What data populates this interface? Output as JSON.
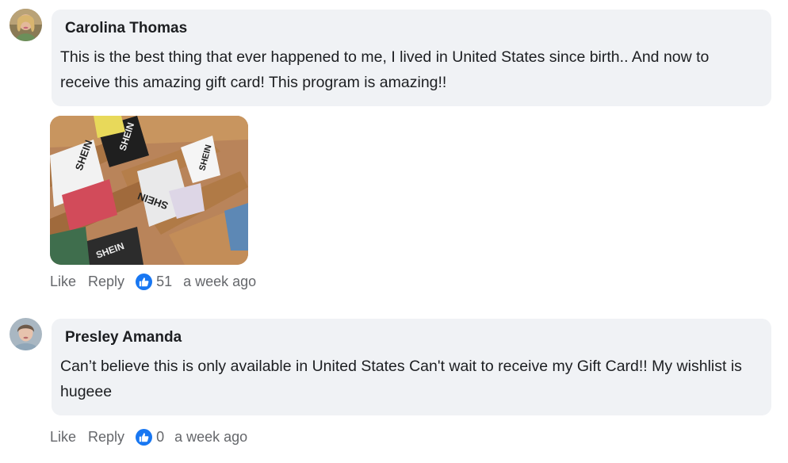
{
  "comments": [
    {
      "author": "Carolina Thomas",
      "text": "This is the best thing that ever happened to me, I lived in United States since birth.. And now to receive this amazing gift card! This program is amazing!!",
      "image_alt": "Boxes of SHEIN packages",
      "image_box_text": "SHEIN",
      "actions": {
        "like": "Like",
        "reply": "Reply"
      },
      "reactions": "51",
      "time": "a week ago",
      "reaction_icon": "thumbs-up-icon",
      "reaction_color": "#1877f2"
    },
    {
      "author": "Presley Amanda",
      "text": "Can’t believe this is only available in United States Can't wait to receive my Gift Card!! My wishlist is hugeee",
      "actions": {
        "like": "Like",
        "reply": "Reply"
      },
      "reactions": "0",
      "time": "a week ago",
      "reaction_icon": "thumbs-up-icon",
      "reaction_color": "#1877f2"
    }
  ],
  "colors": {
    "bubble_bg": "#f0f2f5",
    "meta_text": "#65676b",
    "body_text": "#1c1e21"
  }
}
